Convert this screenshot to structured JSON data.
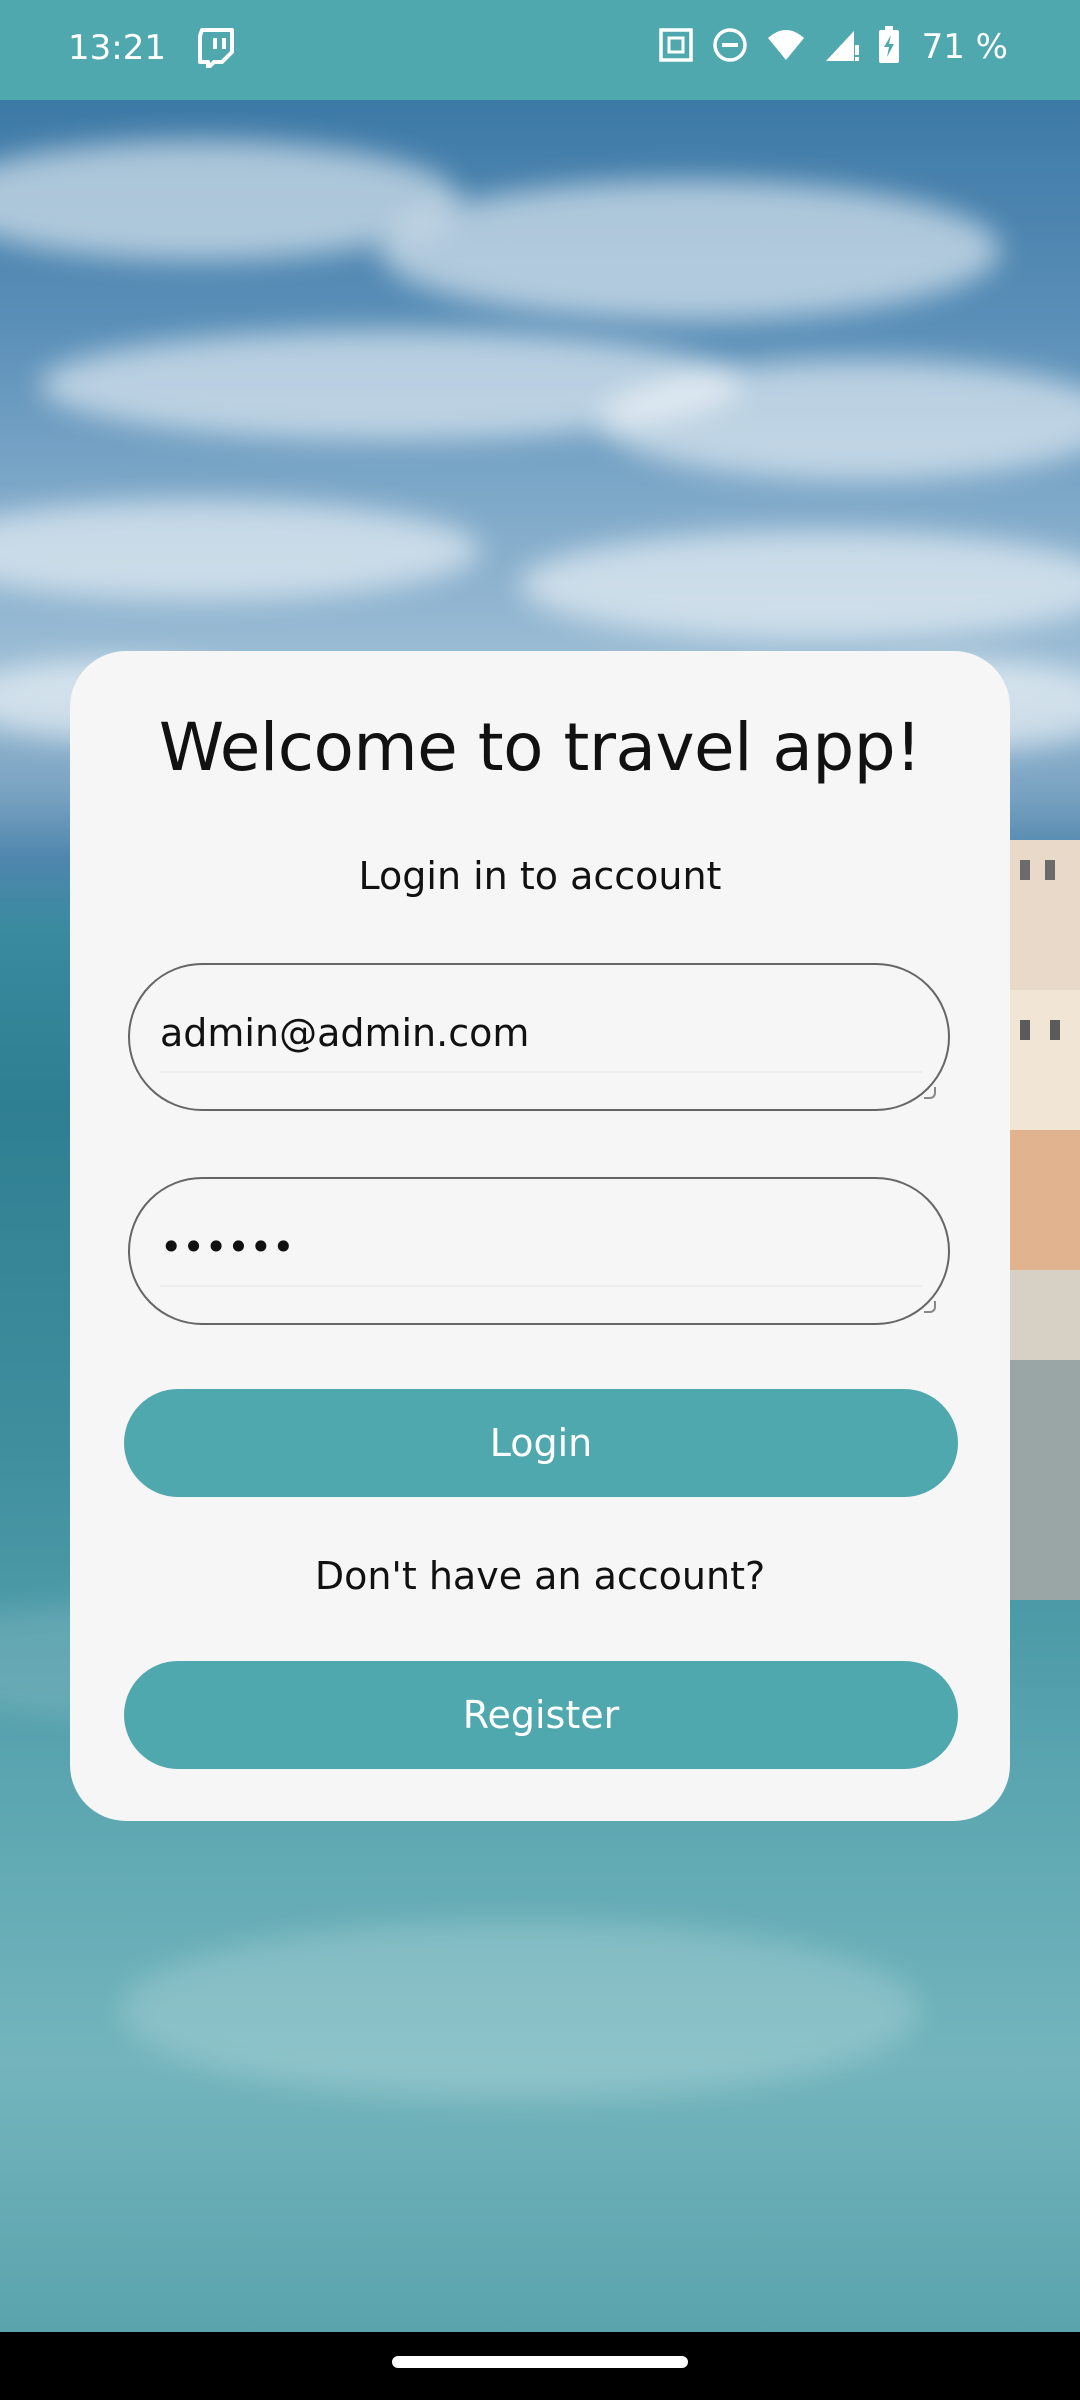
{
  "status_bar": {
    "time": "13:21",
    "battery_percent": "71 %",
    "icons": [
      "twitch-icon",
      "nfc-icon",
      "do-not-disturb-icon",
      "wifi-icon",
      "signal-icon",
      "battery-charging-icon"
    ]
  },
  "login_card": {
    "title": "Welcome to travel app!",
    "subtitle": "Login in to account",
    "email_value": "admin@admin.com",
    "password_value": "••••••",
    "login_label": "Login",
    "no_account_text": "Don't have an account?",
    "register_label": "Register"
  },
  "colors": {
    "accent": "#4fa8ad",
    "card_background": "#f6f6f6",
    "text": "#111111"
  }
}
